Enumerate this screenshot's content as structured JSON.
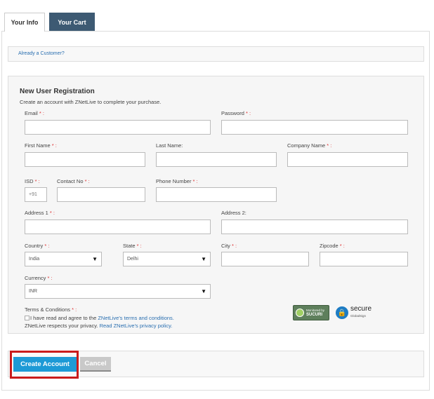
{
  "tabs": [
    {
      "label": "Your Info",
      "active": true
    },
    {
      "label": "Your Cart",
      "active": false
    }
  ],
  "existing": {
    "link": "Already a Customer?"
  },
  "registration": {
    "title": "New User Registration",
    "subtitle": "Create an account with ZNetLive to complete your purchase."
  },
  "fields": {
    "email": {
      "label": "Email",
      "value": ""
    },
    "password": {
      "label": "Password",
      "value": ""
    },
    "first_name": {
      "label": "First Name",
      "value": ""
    },
    "last_name": {
      "label": "Last Name:",
      "value": ""
    },
    "company_name": {
      "label": "Company Name",
      "value": ""
    },
    "isd": {
      "label": "ISD",
      "value": "+91"
    },
    "contact_no": {
      "label": "Contact No",
      "value": ""
    },
    "phone_number": {
      "label": "Phone Number",
      "value": ""
    },
    "address1": {
      "label": "Address 1",
      "value": ""
    },
    "address2": {
      "label": "Address 2:",
      "value": ""
    },
    "country": {
      "label": "Country",
      "value": "India"
    },
    "state": {
      "label": "State",
      "value": "Delhi"
    },
    "city": {
      "label": "City",
      "value": ""
    },
    "zipcode": {
      "label": "Zipcode",
      "value": ""
    },
    "currency": {
      "label": "Currency",
      "value": "INR"
    }
  },
  "terms": {
    "label": "Terms & Conditions",
    "line1_prefix": "I have read and agree to the ",
    "line1_link": "ZNetLive's terms and conditions.",
    "line2_prefix": "ZNetLive respects your privacy. ",
    "line2_link": "Read ZNetLive's privacy policy."
  },
  "required_marker": "* :",
  "badges": {
    "sucuri_line1": "Monitored by",
    "sucuri_line2": "SUCURI",
    "globalsign_main": "secure",
    "globalsign_sub": "GlobalSign"
  },
  "actions": {
    "create": "Create Account",
    "cancel": "Cancel"
  },
  "colors": {
    "tab_cart_bg": "#3d5a73",
    "primary_button": "#1d9ad6",
    "highlight": "#c91b1b",
    "required": "#d33"
  }
}
